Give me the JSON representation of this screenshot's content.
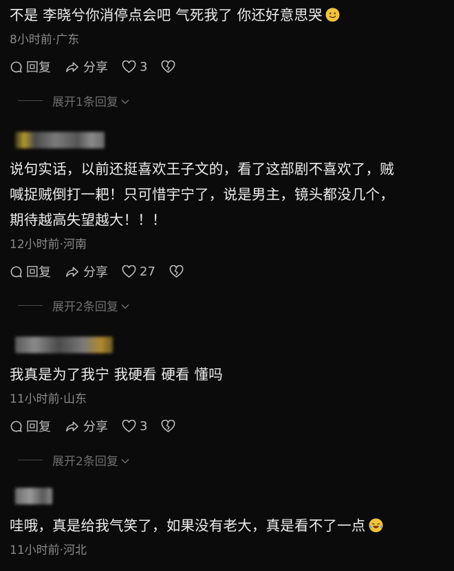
{
  "comments": [
    {
      "text_lines": [
        "不是  李晓兮你消停点会吧 气死我了 你还好意思哭"
      ],
      "emoji_icon": "smiling-face-emoji",
      "meta": "8小时前·广东",
      "reply_label": "回复",
      "share_label": "分享",
      "likes": "3",
      "expand_label": "展开1条回复"
    },
    {
      "text_lines": [
        "说句实话，以前还挺喜欢王子文的，看了这部剧不喜欢了，贼",
        "喊捉贼倒打一耙！只可惜宇宁了，说是男主，镜头都没几个，",
        "期待越高失望越大！！！"
      ],
      "meta": "12小时前·河南",
      "reply_label": "回复",
      "share_label": "分享",
      "likes": "27",
      "expand_label": "展开2条回复"
    },
    {
      "text_lines": [
        "我真是为了我宁 我硬看 硬看 懂吗"
      ],
      "meta": "11小时前·山东",
      "reply_label": "回复",
      "share_label": "分享",
      "likes": "3",
      "expand_label": "展开2条回复"
    },
    {
      "text_lines": [
        "哇哦，真是给我气笑了，如果没有老大，真是看不了一点"
      ],
      "emoji_icon": "laughing-crying-emoji",
      "meta": "11小时前·河北"
    }
  ],
  "colors": {
    "background": "#0b0b0b",
    "text": "#ededed",
    "meta": "#8a8a8a",
    "muted": "#6f6f6f",
    "emoji": "#f3c33a"
  }
}
